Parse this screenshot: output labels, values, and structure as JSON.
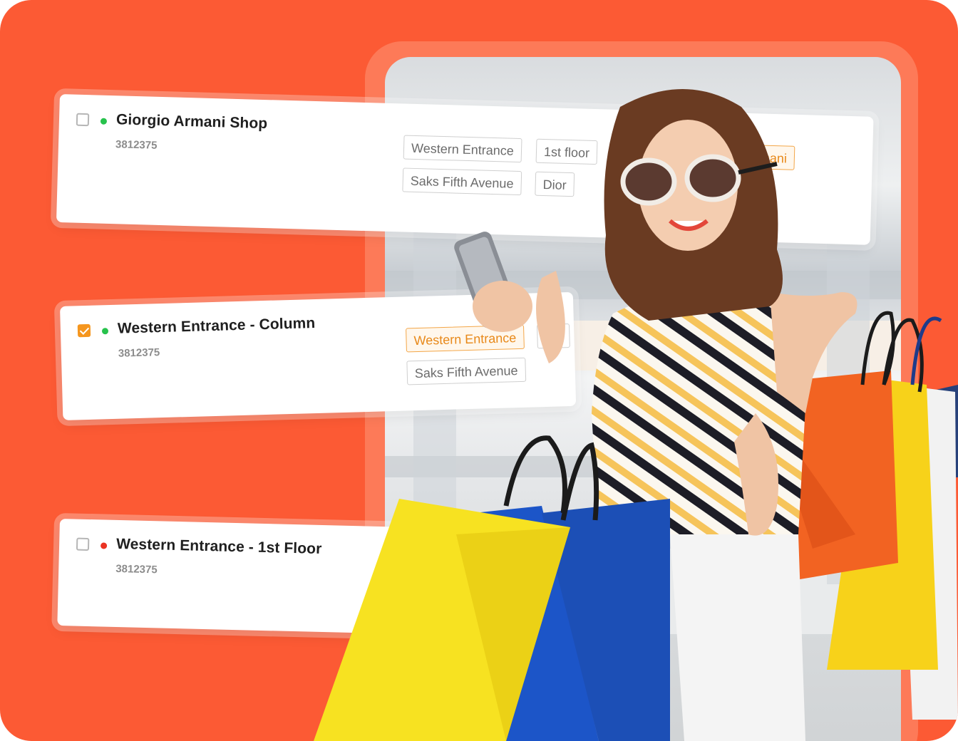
{
  "colors": {
    "background": "#fc5a34",
    "accent_tag_border": "#f3a648",
    "accent_tag_text": "#e8891a",
    "status_online": "#27c24c",
    "status_offline": "#ea3323"
  },
  "locations": [
    {
      "name": "Giorgio Armani Shop",
      "code": "3812375",
      "checked": false,
      "status": "online",
      "tags": [
        "Western Entrance",
        "1st floor",
        "Saks Fifth Avenue",
        "Dior",
        "Armani"
      ]
    },
    {
      "name": "Western Entrance - Column",
      "code": "3812375",
      "checked": true,
      "status": "online",
      "tags": [
        "Western Entrance",
        "1st",
        "Saks Fifth Avenue"
      ]
    },
    {
      "name": "Western Entrance - 1st Floor",
      "code": "3812375",
      "checked": false,
      "status": "offline",
      "tags": []
    }
  ]
}
